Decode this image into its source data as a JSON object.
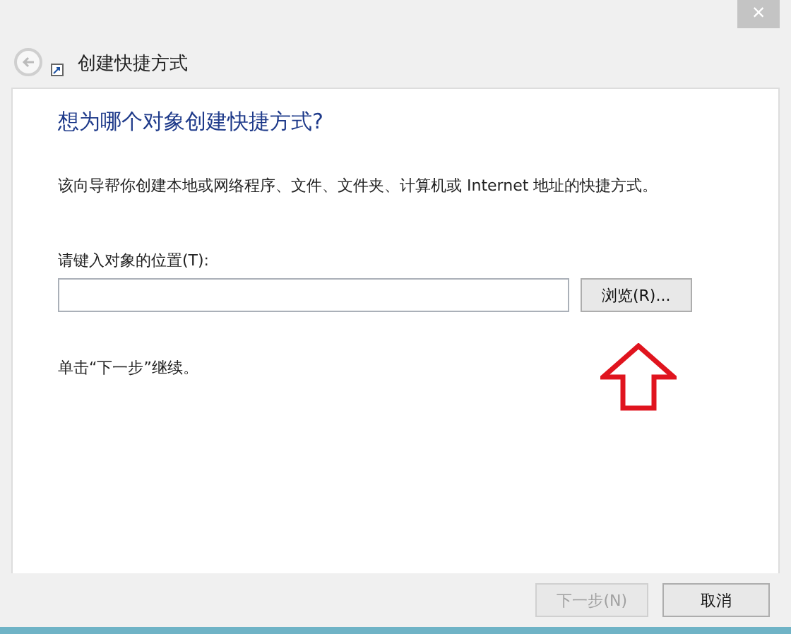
{
  "window": {
    "close_glyph": "×",
    "title": "创建快捷方式"
  },
  "heading": "想为哪个对象创建快捷方式?",
  "description": "该向导帮你创建本地或网络程序、文件、文件夹、计算机或 Internet 地址的快捷方式。",
  "location": {
    "label": "请键入对象的位置(T):",
    "browse": "浏览(R)..."
  },
  "hint": "单击“下一步”继续。",
  "buttons": [
    {
      "label": "下一步(N)",
      "disabled": true
    },
    {
      "label": "取消",
      "disabled": false
    }
  ]
}
